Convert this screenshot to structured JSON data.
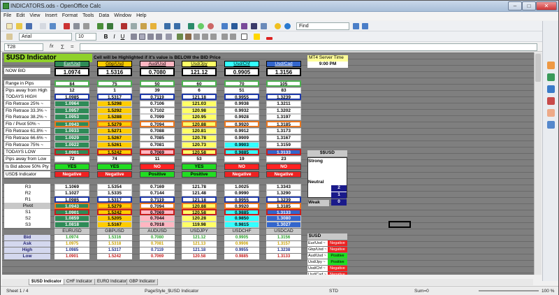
{
  "window": {
    "title": "INDICATORS.ods - OpenOffice Calc",
    "min": "–",
    "max": "□",
    "close": "✕"
  },
  "menu": [
    "File",
    "Edit",
    "View",
    "Insert",
    "Format",
    "Tools",
    "Data",
    "Window",
    "Help"
  ],
  "toolbar": {
    "font": "Arial",
    "size": "10",
    "find": "Find",
    "zoom_box": "100%"
  },
  "formula": {
    "cellref": "T28",
    "fx": "fx",
    "sum": "Σ",
    "eq": "=",
    "value": ""
  },
  "sheet": {
    "title": "$USD  Indicator",
    "note": "Cell will be Highlighted if it's value is BELOW the BID Price",
    "pairs": [
      "Eur/Usd",
      "Gbp/Usd",
      "Aud/Usd",
      "Usd/Jpy",
      "Usd/Chf",
      "Usd/Cad"
    ],
    "pair_colors": [
      "#2e8b57",
      "#ffcc00",
      "#ffb6c1",
      "#ffff66",
      "#33ffff",
      "#3366cc"
    ],
    "labels": [
      "NOW BID",
      "",
      "Range in Pips",
      "Pips away from High",
      "TODAYS HIGH",
      "Fib Retrace 25% ~",
      "Fib Retrace 33.3% ~",
      "Fib Retrace 38.2% ~",
      "Fib / Pivot 50% ~",
      "Fib Retrace 61.8% ~",
      "Fib Retrace 66.6% ~",
      "Fib Retrace 75% ~",
      "TODAYS LOW",
      "Pips away from Low",
      "Is Bid above 50% Pty",
      "USD$ Indicator",
      "",
      "R3",
      "R2",
      "R1",
      "Pivot",
      "S1",
      "S2",
      "S3"
    ],
    "rows": {
      "nowbid": [
        "1.0974",
        "1.5316",
        "0.7080",
        "121.12",
        "0.9905",
        "1.3156"
      ],
      "range": [
        "84",
        "75",
        "50",
        "60",
        "70",
        "105"
      ],
      "pipshigh": [
        "12",
        "1",
        "39",
        "6",
        "51",
        "83"
      ],
      "high": [
        "1.0985",
        "1.5317",
        "0.7119",
        "121.18",
        "0.9955",
        "1.3239"
      ],
      "fib25": [
        "1.0964",
        "1.5298",
        "0.7106",
        "121.03",
        "0.9938",
        "1.3211"
      ],
      "fib333": [
        "1.0957",
        "1.5292",
        "0.7102",
        "120.98",
        "0.9932",
        "1.3202"
      ],
      "fib382": [
        "1.0953",
        "1.5288",
        "0.7099",
        "120.95",
        "0.9928",
        "1.3197"
      ],
      "fib50": [
        "1.0943",
        "1.5279",
        "0.7094",
        "120.88",
        "0.9920",
        "1.3185"
      ],
      "fib618": [
        "1.0933",
        "1.5271",
        "0.7088",
        "120.81",
        "0.9912",
        "1.3173"
      ],
      "fib666": [
        "1.0929",
        "1.5267",
        "0.7085",
        "120.78",
        "0.9909",
        "1.3167"
      ],
      "fib75": [
        "1.0922",
        "1.5261",
        "0.7081",
        "120.73",
        "0.9903",
        "1.3159"
      ],
      "low": [
        "1.0901",
        "1.5242",
        "0.7069",
        "120.58",
        "0.9885",
        "1.3133"
      ],
      "pipslow": [
        "72",
        "74",
        "11",
        "53",
        "19",
        "23"
      ],
      "above": [
        "YES",
        "YES",
        "NO",
        "YES",
        "NO",
        "NO"
      ],
      "ind": [
        "Negative",
        "Negative",
        "Positive",
        "Positive",
        "Negative",
        "Negative"
      ],
      "r3": [
        "1.1069",
        "1.5354",
        "0.7169",
        "121.78",
        "1.0025",
        "1.3343"
      ],
      "r2": [
        "1.1027",
        "1.5335",
        "0.7144",
        "121.48",
        "0.9990",
        "1.3290"
      ],
      "r1": [
        "1.0985",
        "1.5317",
        "0.7119",
        "121.18",
        "0.9955",
        "1.3239"
      ],
      "pivot": [
        "1.0943",
        "1.5279",
        "0.7094",
        "120.88",
        "0.9920",
        "1.3185"
      ],
      "s1": [
        "1.0901",
        "1.5242",
        "0.7069",
        "120.58",
        "0.9885",
        "1.3133"
      ],
      "s2": [
        "1.0859",
        "1.5205",
        "0.7044",
        "120.28",
        "0.9850",
        "1.3080"
      ],
      "s3": [
        "1.0818",
        "1.5167",
        "0.7018",
        "119.98",
        "0.9815",
        "1.3027"
      ]
    },
    "bottom": {
      "headers": [
        "EURUSD",
        "GBPUSD",
        "AUDUSD",
        "USDJPY",
        "USDCHF",
        "USDCAD"
      ],
      "labels": [
        "Bid",
        "Ask",
        "High",
        "Low"
      ],
      "bid": [
        "1.0974",
        "1.5316",
        "0.7080",
        "121.12",
        "0.9905",
        "1.3156"
      ],
      "ask": [
        "1.0975",
        "1.5318",
        "0.7081",
        "121.13",
        "0.9906",
        "1.3157"
      ],
      "high": [
        "1.0985",
        "1.5317",
        "0.7119",
        "121.18",
        "0.9955",
        "1.3238"
      ],
      "low": [
        "1.0901",
        "1.5242",
        "0.7069",
        "120.58",
        "0.9885",
        "1.3133"
      ]
    },
    "server": {
      "label": "MT4 Server Time",
      "time": "9:00 PM"
    },
    "strength": {
      "title": "$$USD",
      "strong": "Strong",
      "neutral": "Neutral",
      "weak": "Weak",
      "v1": "2",
      "v2": "1",
      "v3": "0"
    },
    "usdlist": {
      "title": "$USD",
      "rows": [
        [
          "Eur/Usd ~",
          "Negative"
        ],
        [
          "Gbp/Usd ~",
          "Negative"
        ],
        [
          "Aud/Usd ~",
          "Positive"
        ],
        [
          "Usd/Jpy ~",
          "Positive"
        ],
        [
          "Usd/Chf ~",
          "Negative"
        ],
        [
          "Usd/Cad ~",
          "Negative"
        ]
      ]
    }
  },
  "tabs": [
    "$USD Indicator",
    "CHF Indicator",
    "EURO Indicator",
    "GBP Indicator"
  ],
  "status": {
    "sheet": "Sheet 1 / 4",
    "style": "PageStyle_$USD Indicator",
    "mode": "STD",
    "sum": "Sum=0",
    "zoom": "100 %"
  }
}
